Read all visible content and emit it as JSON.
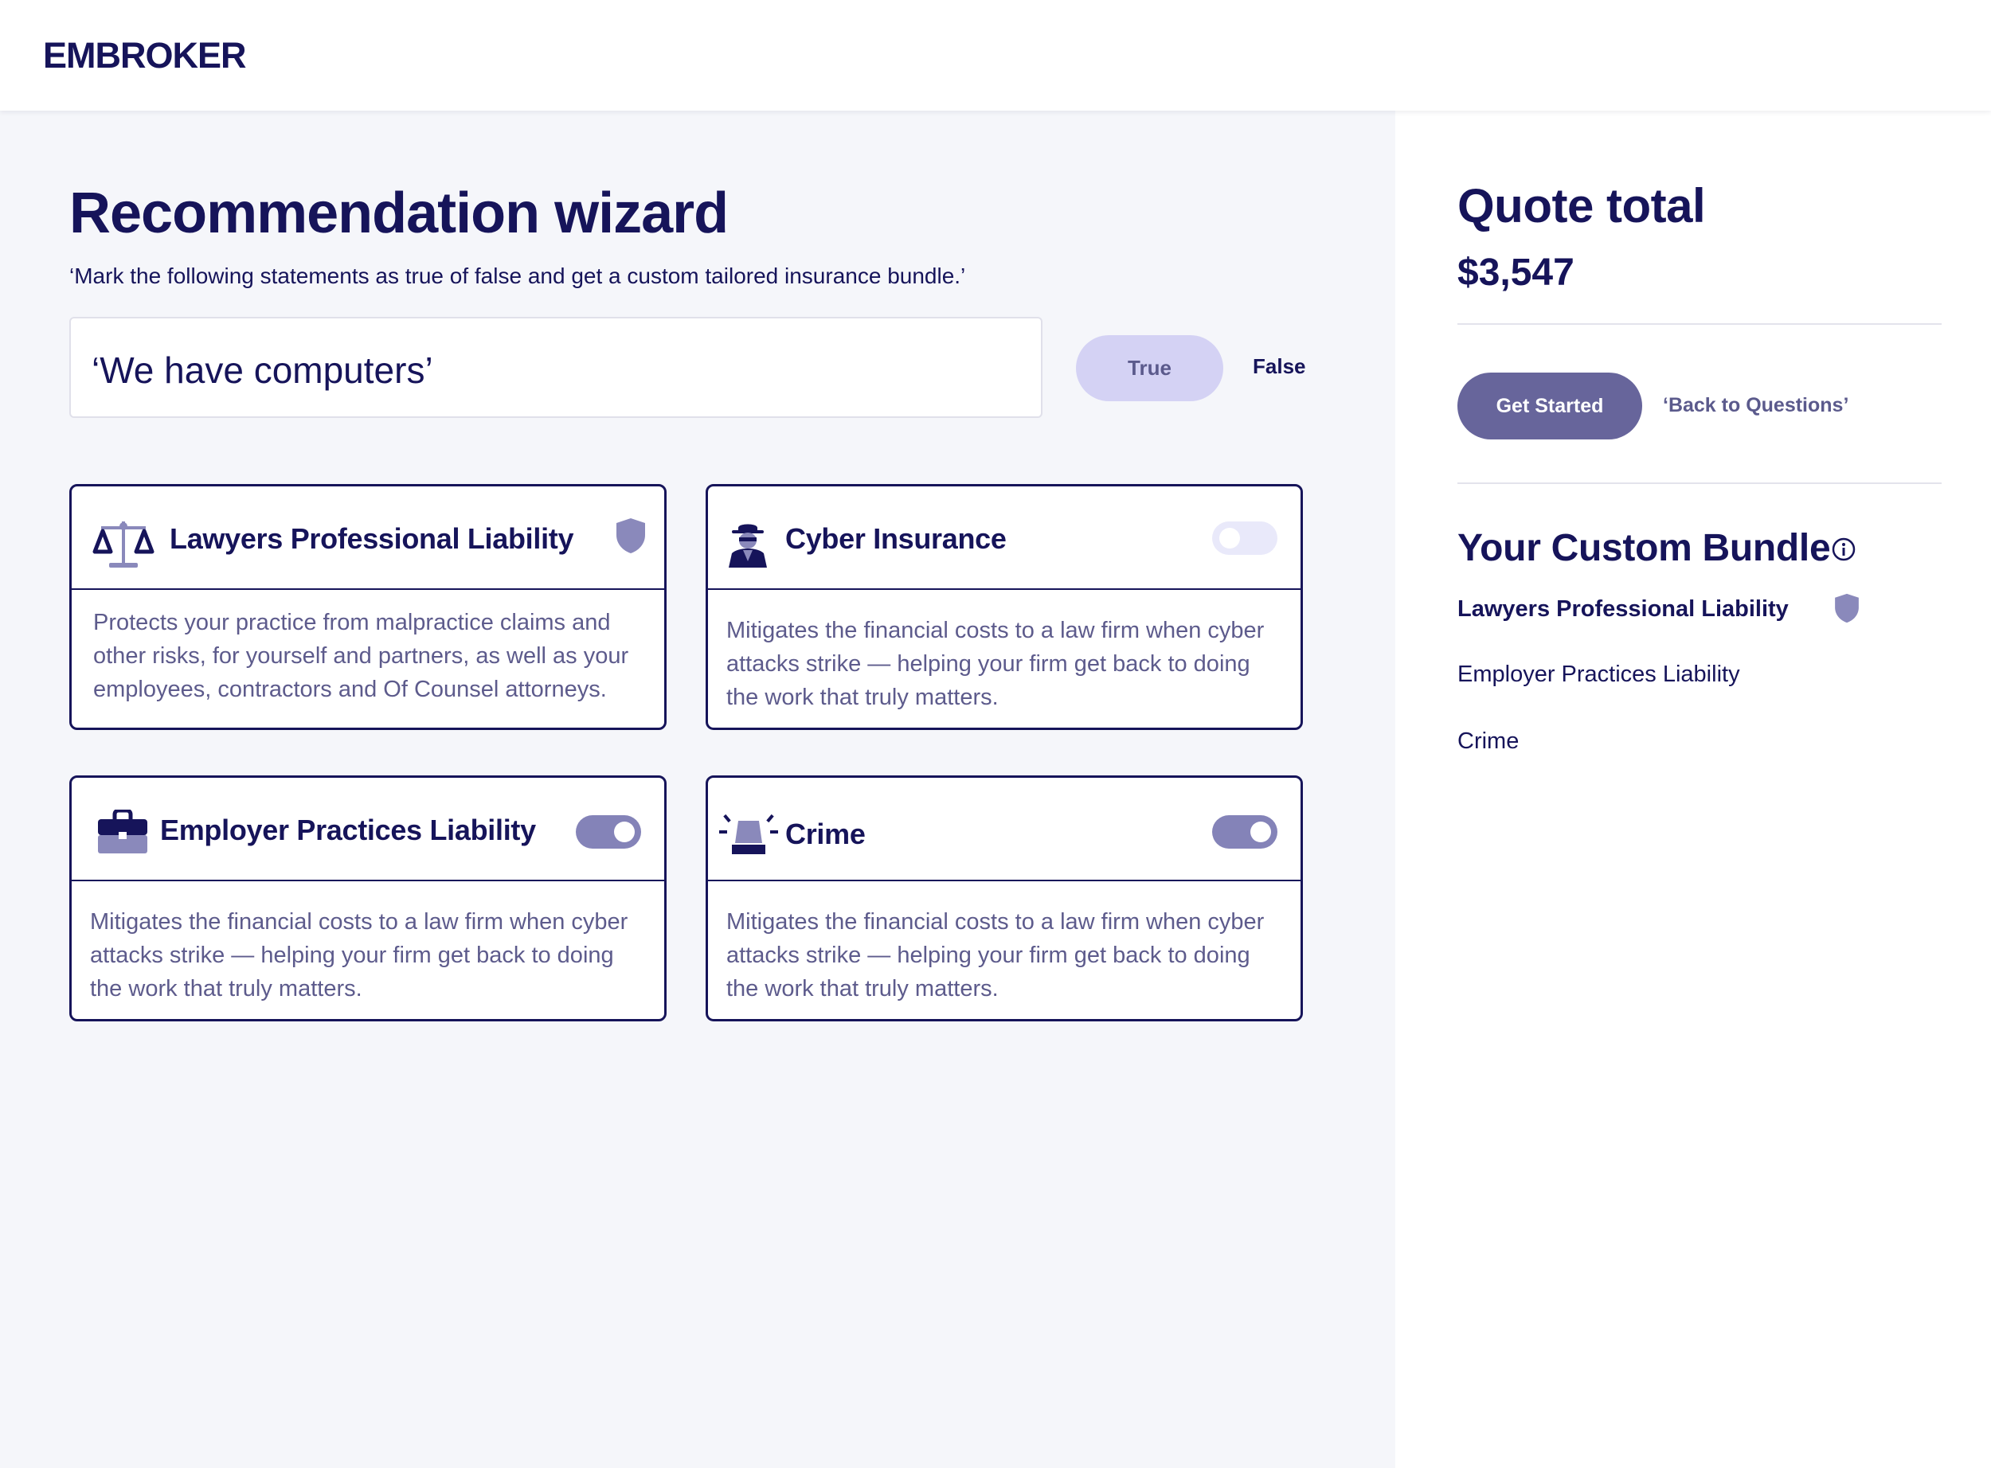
{
  "header": {
    "logo": "EMBROKER"
  },
  "wizard": {
    "title": "Recommendation wizard",
    "subtitle": "‘Mark the following statements as true of false and get a custom tailored insurance bundle.’",
    "statement": "‘We have computers’",
    "true_label": "True",
    "false_label": "False",
    "selected": "True"
  },
  "cards": [
    {
      "title": "Lawyers Professional Liability",
      "icon": "scales-icon",
      "status": "included-shield",
      "description": "Protects your practice from malpractice claims and other risks, for yourself and partners, as well as your employees, contractors and Of Counsel attorneys."
    },
    {
      "title": "Cyber Insurance",
      "icon": "hacker-icon",
      "toggle": "off",
      "description": "Mitigates the financial costs to a law firm when cyber attacks strike — helping your firm get back to doing the work that truly matters."
    },
    {
      "title": "Employer Practices Liability",
      "icon": "briefcase-icon",
      "toggle": "on",
      "description": "Mitigates the financial costs to a law firm when cyber attacks strike — helping your firm get back to doing the work that truly matters."
    },
    {
      "title": "Crime",
      "icon": "alarm-siren-icon",
      "toggle": "on",
      "description": "Mitigates the financial costs to a law firm when cyber attacks strike — helping your firm get back to doing the work that truly matters."
    }
  ],
  "sidebar": {
    "quote_title": "Quote total",
    "quote_amount": "$3,547",
    "get_started": "Get Started",
    "back_link": "‘Back to Questions’",
    "bundle_title": "Your Custom Bundle",
    "bundle_items": [
      {
        "label": "Lawyers Professional Liability"
      },
      {
        "label": "Employer Practices Liability"
      },
      {
        "label": "Crime"
      }
    ]
  },
  "colors": {
    "navy": "#16145a",
    "muted_text": "#5d5b8c",
    "toggle_on": "#8483b8",
    "true_button": "#d4d2f4",
    "primary_button": "#67659b",
    "page_bg": "#f5f6fa"
  }
}
